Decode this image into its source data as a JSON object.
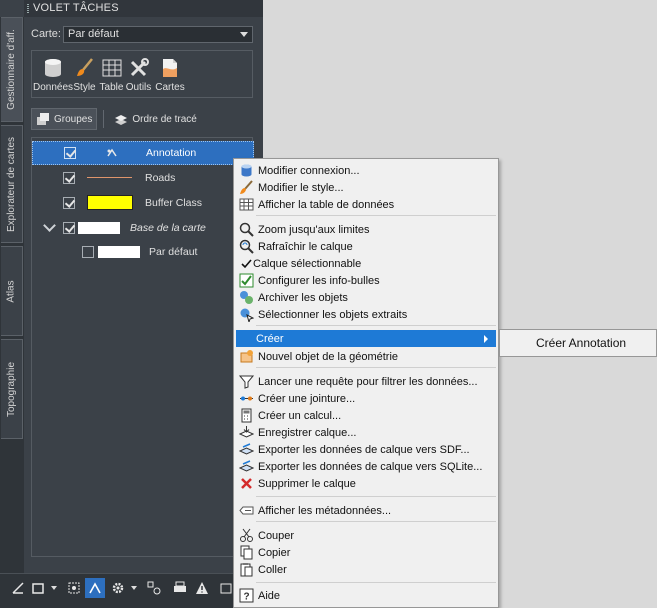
{
  "panel": {
    "title": "VOLET TÂCHES",
    "vertical_tabs": [
      "Gestionnaire d'aff.",
      "Explorateur de cartes",
      "Atlas",
      "Topographie"
    ],
    "map_label": "Carte:",
    "map_value": "Par défaut",
    "toolbar": [
      "Données",
      "Style",
      "Table",
      "Outils",
      "Cartes"
    ],
    "tabs": [
      "Groupes",
      "Ordre de tracé"
    ],
    "layers": [
      {
        "name": "Annotation",
        "checked": true,
        "selected": true
      },
      {
        "name": "Roads",
        "checked": true
      },
      {
        "name": "Buffer Class",
        "checked": true,
        "swatch": "#ffff00"
      },
      {
        "name": "Base de la carte",
        "checked": true,
        "italic": true
      },
      {
        "name": "Par défaut",
        "checked": false
      }
    ]
  },
  "menu": {
    "items": [
      {
        "label": "Modifier connexion...",
        "icon": "database-icon"
      },
      {
        "label": "Modifier le style...",
        "icon": "brush-icon"
      },
      {
        "label": "Afficher la table de données",
        "icon": "table-icon"
      },
      {
        "label": "Zoom jusqu'aux limites",
        "icon": "zoom-icon"
      },
      {
        "label": "Rafraîchir le calque",
        "icon": "refresh-icon"
      },
      {
        "label": "Calque sélectionnable",
        "icon": "check-icon"
      },
      {
        "label": "Configurer les info-bulles",
        "icon": "tooltip-icon"
      },
      {
        "label": "Archiver les objets",
        "icon": "archive-icon"
      },
      {
        "label": "Sélectionner les objets extraits",
        "icon": "select-extracted-icon"
      },
      {
        "label": "Créer",
        "icon": "",
        "highlighted": true
      },
      {
        "label": "Nouvel objet de la géométrie",
        "icon": "new-feature-icon"
      },
      {
        "label": "Lancer une requête pour filtrer les données...",
        "icon": "filter-icon"
      },
      {
        "label": "Créer une jointure...",
        "icon": "join-icon"
      },
      {
        "label": "Créer un calcul...",
        "icon": "calculator-icon"
      },
      {
        "label": "Enregistrer calque...",
        "icon": "save-layer-icon"
      },
      {
        "label": "Exporter les données de calque vers SDF...",
        "icon": "export-sdf-icon"
      },
      {
        "label": "Exporter les données de calque vers SQLite...",
        "icon": "export-sqlite-icon"
      },
      {
        "label": "Supprimer le calque",
        "icon": "delete-icon"
      },
      {
        "label": "Afficher les métadonnées...",
        "icon": "metadata-icon"
      },
      {
        "label": "Couper",
        "icon": "cut-icon"
      },
      {
        "label": "Copier",
        "icon": "copy-icon"
      },
      {
        "label": "Coller",
        "icon": "paste-icon"
      },
      {
        "label": "Aide",
        "icon": "help-icon"
      }
    ],
    "submenu": {
      "label": "Créer Annotation"
    }
  },
  "colors": {
    "highlight": "#1e7ad6",
    "panel_bg": "#3b4148",
    "selected_layer": "#2d6fbf"
  }
}
